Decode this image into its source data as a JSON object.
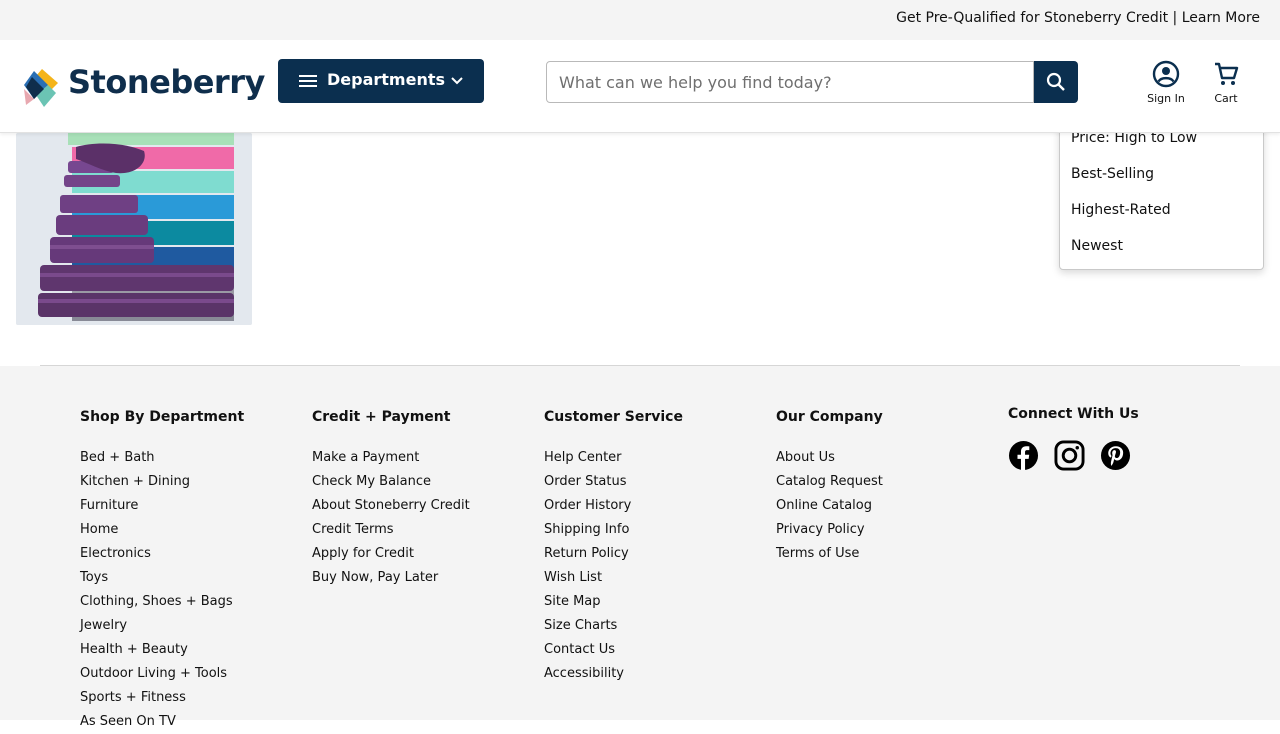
{
  "promo": {
    "text": "Get Pre-Qualified for Stoneberry Credit | Learn More"
  },
  "header": {
    "logo_text": "Stoneberry",
    "departments_label": "Departments",
    "search_placeholder": "What can we help you find today?",
    "sign_in_label": "Sign In",
    "cart_label": "Cart",
    "colors": {
      "navy": "#0b2f4f",
      "accent_yellow": "#f4b41a",
      "accent_blue": "#2a6fb4",
      "accent_teal": "#6bc4b4",
      "accent_pink": "#e8a8b0"
    }
  },
  "product": {
    "image_icon": "towel-set-image"
  },
  "sort_menu": {
    "options": [
      "Price: High to Low",
      "Best-Selling",
      "Highest-Rated",
      "Newest"
    ]
  },
  "footer": {
    "columns": [
      {
        "title": "Shop By Department",
        "links": [
          "Bed + Bath",
          "Kitchen + Dining",
          "Furniture",
          "Home",
          "Electronics",
          "Toys",
          "Clothing, Shoes + Bags",
          "Jewelry",
          "Health + Beauty",
          "Outdoor Living + Tools",
          "Sports + Fitness",
          "As Seen On TV"
        ]
      },
      {
        "title": "Credit + Payment",
        "links": [
          "Make a Payment",
          "Check My Balance",
          "About Stoneberry Credit",
          "Credit Terms",
          "Apply for Credit",
          "Buy Now, Pay Later"
        ]
      },
      {
        "title": "Customer Service",
        "links": [
          "Help Center",
          "Order Status",
          "Order History",
          "Shipping Info",
          "Return Policy",
          "Wish List",
          "Site Map",
          "Size Charts",
          "Contact Us",
          "Accessibility"
        ]
      },
      {
        "title": "Our Company",
        "links": [
          "About Us",
          "Catalog Request",
          "Online Catalog",
          "Privacy Policy",
          "Terms of Use"
        ]
      }
    ],
    "connect": {
      "title": "Connect With Us",
      "icons": [
        "facebook-icon",
        "instagram-icon",
        "pinterest-icon"
      ]
    }
  }
}
